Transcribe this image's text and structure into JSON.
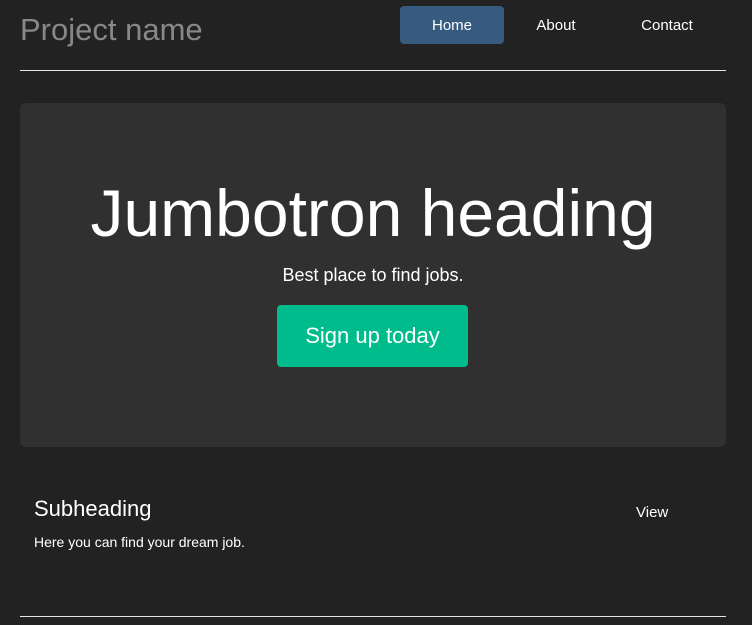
{
  "header": {
    "project_name": "Project name",
    "nav": {
      "home": "Home",
      "about": "About",
      "contact": "Contact"
    },
    "active_item": "Home",
    "active_color": "#375a7f"
  },
  "jumbotron": {
    "heading": "Jumbotron heading",
    "lead": "Best place to find jobs.",
    "cta_label": "Sign up today",
    "cta_color": "#00bc8c"
  },
  "section": {
    "subheading": "Subheading",
    "text": "Here you can find your dream job.",
    "link_label": "View"
  },
  "colors": {
    "background": "#222222",
    "panel": "#303030"
  }
}
